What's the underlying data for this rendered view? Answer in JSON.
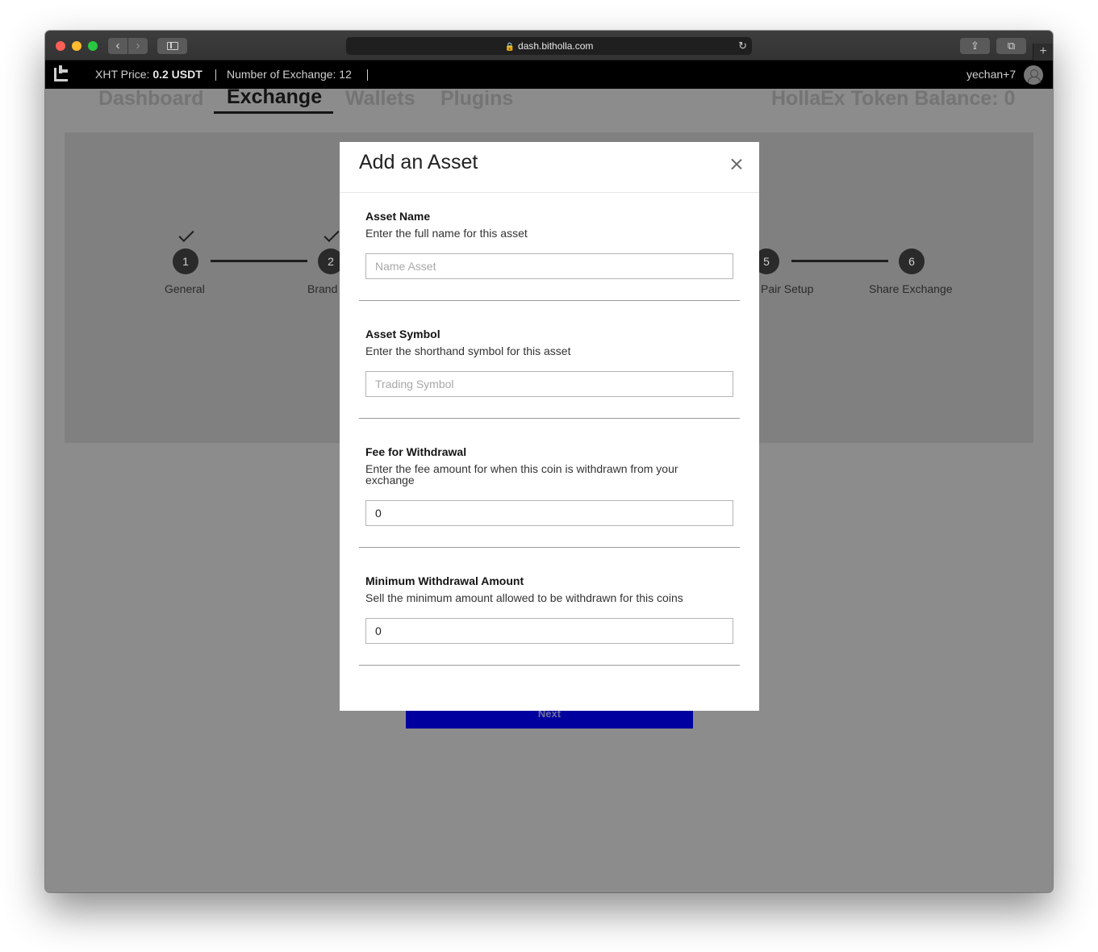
{
  "browser": {
    "url": "dash.bitholla.com"
  },
  "header": {
    "xht_price_label": "XHT Price:",
    "xht_price_value": "0.2 USDT",
    "exchanges_label": "Number of Exchange: 12",
    "username": "yechan+7"
  },
  "nav": {
    "tabs": [
      {
        "label": "Dashboard"
      },
      {
        "label": "Exchange"
      },
      {
        "label": "Wallets"
      },
      {
        "label": "Plugins"
      }
    ],
    "active_tab": "Exchange",
    "token_balance": "HollaEx Token Balance: 0"
  },
  "steps": [
    {
      "number": "1",
      "label": "General",
      "completed": true
    },
    {
      "number": "2",
      "label": "Brand",
      "completed": true
    },
    {
      "number": "5",
      "label": "Pair Setup",
      "completed": false
    },
    {
      "number": "6",
      "label": "Share Exchange",
      "completed": false
    }
  ],
  "next_button": "Next",
  "modal": {
    "title": "Add an Asset",
    "fields": [
      {
        "label": "Asset Name",
        "description": "Enter the full name for this asset",
        "placeholder": "Name Asset",
        "value": ""
      },
      {
        "label": "Asset Symbol",
        "description": "Enter the shorthand symbol for this asset",
        "placeholder": "Trading Symbol",
        "value": ""
      },
      {
        "label": "Fee for Withdrawal",
        "description": "Enter the fee amount for when this coin is withdrawn from your exchange",
        "placeholder": "",
        "value": "0"
      },
      {
        "label": "Minimum Withdrawal Amount",
        "description": "Sell the minimum amount allowed to be withdrawn for this coins",
        "placeholder": "",
        "value": "0"
      }
    ]
  },
  "colors": {
    "overlay_page": "#8c8c8c",
    "header_bg": "#000000",
    "next_button": "#00009e",
    "modal_bg": "#ffffff"
  }
}
